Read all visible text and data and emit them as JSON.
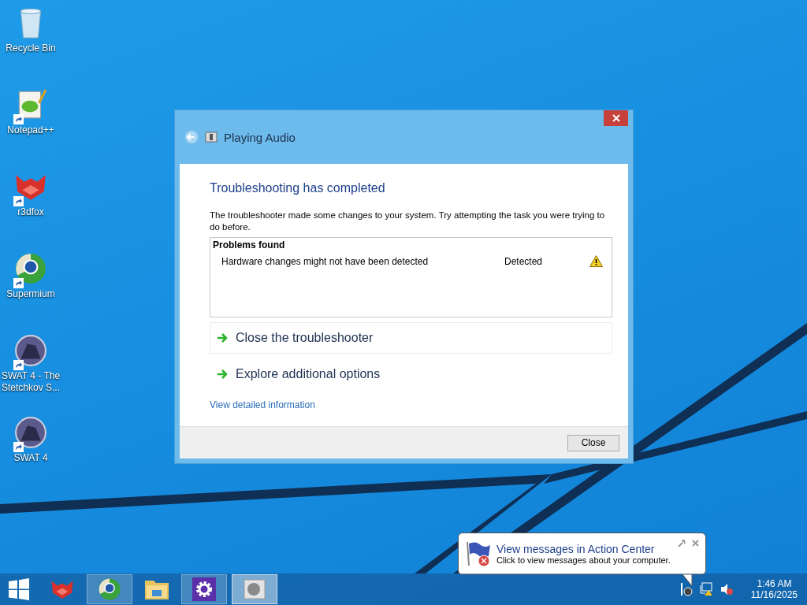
{
  "desktop_icons": [
    {
      "label": "Recycle Bin",
      "kind": "recycle",
      "shortcut": false
    },
    {
      "label": "Notepad++",
      "kind": "notepad",
      "shortcut": true
    },
    {
      "label": "r3dfox",
      "kind": "fox",
      "shortcut": true
    },
    {
      "label": "Supermium",
      "kind": "browser",
      "shortcut": true
    },
    {
      "label": "SWAT 4 - The Stetchkov S...",
      "kind": "game",
      "shortcut": true
    },
    {
      "label": "SWAT 4",
      "kind": "game",
      "shortcut": true
    }
  ],
  "window": {
    "title": "Playing Audio",
    "heading": "Troubleshooting has completed",
    "message": "The troubleshooter made some changes to your system. Try attempting the task you were trying to do before.",
    "problems": {
      "title": "Problems found",
      "rows": [
        {
          "problem": "Hardware changes might not have been detected",
          "status": "Detected",
          "kind": "warning"
        }
      ]
    },
    "options": [
      {
        "label": "Close the troubleshooter",
        "selected": true
      },
      {
        "label": "Explore additional options",
        "selected": false
      }
    ],
    "details_link": "View detailed information",
    "close_button": "Close"
  },
  "notification": {
    "title": "View messages in Action Center",
    "message": "Click to view messages about your computer."
  },
  "taskbar": {
    "apps": [
      {
        "kind": "start",
        "running": false,
        "selected": false
      },
      {
        "kind": "fox",
        "running": false,
        "selected": false
      },
      {
        "kind": "browser",
        "running": true,
        "selected": false
      },
      {
        "kind": "folder",
        "running": false,
        "selected": false
      },
      {
        "kind": "settings",
        "running": true,
        "selected": false
      },
      {
        "kind": "troubleshooter",
        "running": true,
        "selected": true
      }
    ],
    "clock": {
      "time": "1:46 AM",
      "date": "11/16/2025"
    }
  }
}
